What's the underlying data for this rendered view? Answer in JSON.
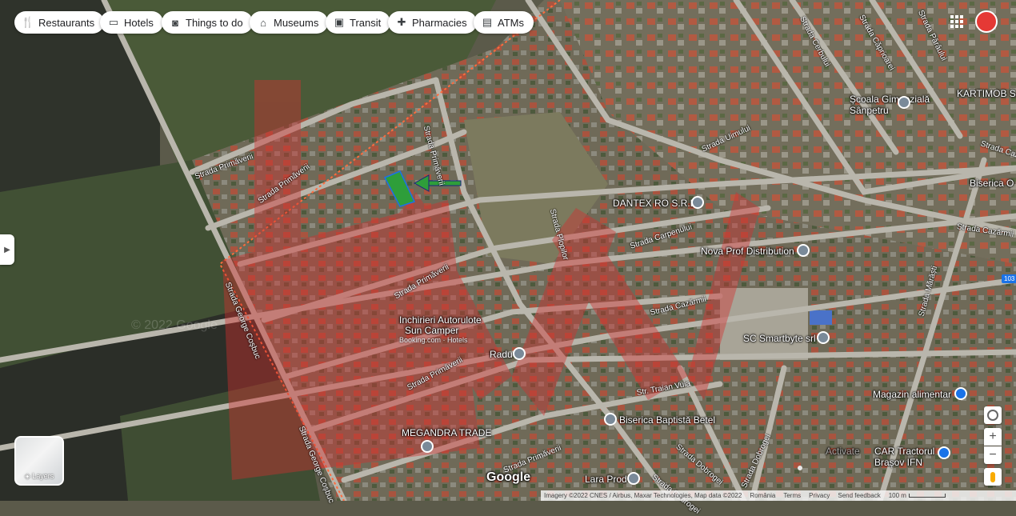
{
  "categories": [
    {
      "label": "Restaurants",
      "icon": "fork-knife-icon"
    },
    {
      "label": "Hotels",
      "icon": "bed-icon"
    },
    {
      "label": "Things to do",
      "icon": "camera-icon"
    },
    {
      "label": "Museums",
      "icon": "museum-icon"
    },
    {
      "label": "Transit",
      "icon": "bus-icon"
    },
    {
      "label": "Pharmacies",
      "icon": "pharmacy-icon"
    },
    {
      "label": "ATMs",
      "icon": "atm-icon"
    }
  ],
  "places": {
    "school": "Școala Gimnazială\nSânpetru",
    "kartimob": "KARTIMOB SA",
    "biserica": "Biserica O",
    "dantex": "DANTEX RO S.R.L",
    "nova": "Nova Prof Distribution",
    "smartbyte": "SC Smartbyte srl",
    "magazin": "Magazin alimentar",
    "baptista": "Biserica Baptistă Betel",
    "megandra": "MEGANDRA TRADE",
    "radu": "Radu",
    "lara": "Lara Prod",
    "car": "CAR Tractorul\nBrașov IFN",
    "camper_1": "Inchirieri Autorulote",
    "camper_2": "Sun Camper",
    "camper_3": "Booking.com · Hotels",
    "activate": "Activate"
  },
  "streets": {
    "primaverii_a": "Strada Primăverii",
    "primaverii_b": "Strada Primăverii",
    "primaverii_c": "Strada Primăverii",
    "primaverii_d": "Strada Primăverii",
    "primaverii_e": "Strada Primăverii",
    "primaverii_f": "Strada Primăverii",
    "plopilor": "Strada Plopilor",
    "uimului": "Strada Uimului",
    "carpenului": "Strada Carpenului",
    "cazarmii": "Strada Cazărmii",
    "cazarmii_b": "Strada Cazărmii",
    "traian_vuia": "Str. Traian Vuia",
    "cosbuc_a": "Strada George Coșbuc",
    "cosbuc_b": "Strada George Coșbuc",
    "dobrogei_a": "Strada Dobrogei",
    "dobrogei_b": "Strada Dobrogei",
    "dobrogei_c": "Strada Dobrogei",
    "marasti": "Strada Mărăști",
    "cerbului": "Strada Cerbului",
    "caprioarei": "Strada Căprioarei",
    "paraului": "Strada Pârâului",
    "cazarmii_c": "Strada Cazărmii"
  },
  "watermark": "© 2022 Google",
  "route_badge": "103",
  "layers_label": "Layers",
  "google_logo": "Google",
  "footer": {
    "imagery": "Imagery ©2022 CNES / Airbus, Maxar Technologies, Map data ©2022",
    "country": "România",
    "terms": "Terms",
    "privacy": "Privacy",
    "feedback": "Send feedback",
    "scale": "100 m"
  },
  "colors": {
    "accent_red": "#e53935",
    "parcel_green": "#2e7d32",
    "arrow_blue": "#1a73e8",
    "overlay_red": "#d32f2f"
  }
}
